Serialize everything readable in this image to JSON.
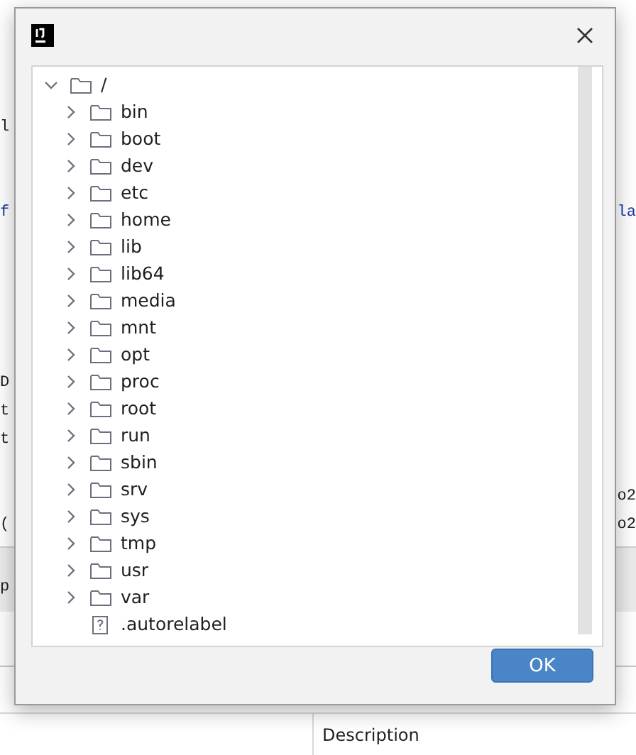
{
  "editor": {
    "lines": [
      {
        "left": "l"
      },
      {
        "left": "f",
        "right": "la"
      },
      {
        "left": "D"
      },
      {
        "left": "t"
      },
      {
        "left": "t"
      },
      {
        "right": "o2"
      },
      {
        "left": "(",
        "right": "o2"
      }
    ],
    "strip": {
      "left": "p"
    }
  },
  "bottom_panel": {
    "columns": [
      "Description"
    ]
  },
  "dialog": {
    "tree": {
      "label": "/",
      "kind": "folder",
      "expanded": true,
      "children": [
        {
          "label": "bin",
          "kind": "folder",
          "expanded": false
        },
        {
          "label": "boot",
          "kind": "folder",
          "expanded": false
        },
        {
          "label": "dev",
          "kind": "folder",
          "expanded": false
        },
        {
          "label": "etc",
          "kind": "folder",
          "expanded": false
        },
        {
          "label": "home",
          "kind": "folder",
          "expanded": false
        },
        {
          "label": "lib",
          "kind": "folder",
          "expanded": false
        },
        {
          "label": "lib64",
          "kind": "folder",
          "expanded": false
        },
        {
          "label": "media",
          "kind": "folder",
          "expanded": false
        },
        {
          "label": "mnt",
          "kind": "folder",
          "expanded": false
        },
        {
          "label": "opt",
          "kind": "folder",
          "expanded": false
        },
        {
          "label": "proc",
          "kind": "folder",
          "expanded": false
        },
        {
          "label": "root",
          "kind": "folder",
          "expanded": false
        },
        {
          "label": "run",
          "kind": "folder",
          "expanded": false
        },
        {
          "label": "sbin",
          "kind": "folder",
          "expanded": false
        },
        {
          "label": "srv",
          "kind": "folder",
          "expanded": false
        },
        {
          "label": "sys",
          "kind": "folder",
          "expanded": false
        },
        {
          "label": "tmp",
          "kind": "folder",
          "expanded": false
        },
        {
          "label": "usr",
          "kind": "folder",
          "expanded": false
        },
        {
          "label": "var",
          "kind": "folder",
          "expanded": false
        },
        {
          "label": ".autorelabel",
          "kind": "file"
        }
      ]
    },
    "buttons": [
      {
        "label": "OK",
        "kind": "primary"
      }
    ]
  }
}
